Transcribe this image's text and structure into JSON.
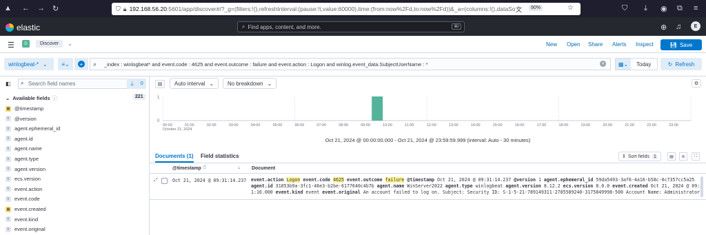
{
  "browser": {
    "url_host": "192.168.56.20",
    "url_rest": ":5601/app/discover#/?_g=(filters:!(),refreshInterval:(pause:!t,value:60000),time:(from:now%2Fd,to:now%2Fd))&_a=(columns:!(),dataSource:(dat",
    "zoom": "90%"
  },
  "header": {
    "logo_text": "elastic",
    "search_placeholder": "Find apps, content, and more.",
    "search_shortcut": "⌘/",
    "user_initial": "E"
  },
  "app_bar": {
    "space_initial": "D",
    "breadcrumb": "Discover",
    "links": [
      "New",
      "Open",
      "Share",
      "Alerts",
      "Inspect"
    ],
    "save_label": "Save"
  },
  "query_bar": {
    "data_view": "winlogbeat-*",
    "query": "_index : winlogbeat* and event.code : 4625 and event.outcome : failure and event.action : Logon and winlog.event_data.SubjectUserName : *",
    "date_label": "Today",
    "refresh_label": "Refresh"
  },
  "sidebar": {
    "search_placeholder": "Search field names",
    "filter_count": "0",
    "available_label": "Available fields",
    "available_count": "221",
    "fields": [
      {
        "name": "@timestamp",
        "type": "date"
      },
      {
        "name": "@version",
        "type": "kw"
      },
      {
        "name": "agent.ephemeral_id",
        "type": "kw"
      },
      {
        "name": "agent.id",
        "type": "kw"
      },
      {
        "name": "agent.name",
        "type": "kw"
      },
      {
        "name": "agent.type",
        "type": "kw"
      },
      {
        "name": "agent.version",
        "type": "kw"
      },
      {
        "name": "ecs.version",
        "type": "kw"
      },
      {
        "name": "event.action",
        "type": "kw"
      },
      {
        "name": "event.code",
        "type": "kw"
      },
      {
        "name": "event.created",
        "type": "date"
      },
      {
        "name": "event.kind",
        "type": "kw"
      },
      {
        "name": "event.original",
        "type": "kw"
      }
    ]
  },
  "chart_toolbar": {
    "interval_label": "Auto interval",
    "breakdown_label": "No breakdown"
  },
  "chart_data": {
    "type": "bar",
    "color": "#54b399",
    "ylim": [
      0,
      1
    ],
    "y_ticks": [
      "1",
      "0"
    ],
    "x_ticks": [
      "00:00",
      "01:00",
      "02:00",
      "03:00",
      "04:00",
      "05:00",
      "06:00",
      "07:00",
      "08:00",
      "09:00",
      "10:00",
      "11:00",
      "12:00",
      "13:00",
      "14:00",
      "15:00",
      "16:00",
      "17:00",
      "18:00",
      "19:00",
      "20:00",
      "21:00",
      "22:00",
      "23:00"
    ],
    "x_subtitle": "October 21, 2024",
    "bars": [
      {
        "x": "09:30",
        "value": 1
      }
    ],
    "time_range": "Oct 21, 2024 @ 00:00:00.000 - Oct 21, 2024 @ 23:59:59.999 (interval: Auto - 30 minutes)"
  },
  "documents": {
    "tab_documents": "Documents (1)",
    "tab_field_stats": "Field statistics",
    "sort_label": "Sort fields",
    "sort_count": "1",
    "col_timestamp": "@timestamp",
    "col_document": "Document",
    "row": {
      "timestamp": "Oct 21, 2024 @ 09:31:14.237",
      "line1": [
        {
          "k": "event.action",
          "v": "Logon",
          "hl": true
        },
        {
          "k": "event.code",
          "v": "4625",
          "hl": true
        },
        {
          "k": "event.outcome",
          "v": "failure",
          "hl": true
        },
        {
          "k": "@timestamp",
          "v": "Oct 21, 2024 @ 09:31:14.237"
        },
        {
          "k": "@version",
          "v": "1"
        },
        {
          "k": "agent.ephemeral_id",
          "v": "59da5493-3af6-4a16-b58c-0c7357cc5a25"
        }
      ],
      "line2": [
        {
          "k": "agent.id",
          "v": "31053b9a-3fc1-46e3-b2be-6177640c4b7b"
        },
        {
          "k": "agent.name",
          "v": "WinServer2022"
        },
        {
          "k": "agent.type",
          "v": "winlogbeat"
        },
        {
          "k": "agent.version",
          "v": "8.12.2"
        },
        {
          "k": "ecs.version",
          "v": "8.0.0"
        },
        {
          "k": "event.created",
          "v": "Oct 21, 2024 @ 09:3"
        }
      ],
      "line3": [
        {
          "k": "",
          "v": "1:16.000"
        },
        {
          "k": "event.kind",
          "v": "event"
        },
        {
          "k": "event.original",
          "v": "An account failed to log on. Subject: Security ID: S-1-5-21-789149311-2785589240-3175849998-500 Account Name: Administrator A…"
        }
      ]
    }
  }
}
